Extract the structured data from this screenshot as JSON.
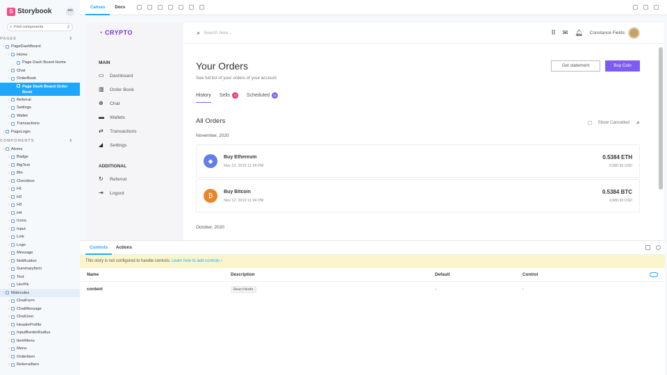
{
  "storybook": {
    "title": "Storybook",
    "search_placeholder": "Find components",
    "search_key": "/",
    "sections": [
      {
        "label": "PAGES"
      },
      {
        "label": "COMPONENTS"
      }
    ],
    "pages_tree": [
      {
        "label": "PageDashBoard",
        "level": 0
      },
      {
        "label": "Home",
        "level": 1
      },
      {
        "label": "Page Dash Board Home",
        "level": 2
      },
      {
        "label": "Chat",
        "level": 1
      },
      {
        "label": "OrderBook",
        "level": 1
      },
      {
        "label": "Page Dash Board Order Book",
        "level": 2,
        "selected": true
      },
      {
        "label": "Referral",
        "level": 1
      },
      {
        "label": "Settings",
        "level": 1
      },
      {
        "label": "Wallet",
        "level": 1
      },
      {
        "label": "Transactions",
        "level": 1
      },
      {
        "label": "PageLogin",
        "level": 0
      }
    ],
    "components_tree": [
      {
        "label": "Atoms",
        "level": 0
      },
      {
        "label": "Badge",
        "level": 1
      },
      {
        "label": "BigText",
        "level": 1
      },
      {
        "label": "Btn",
        "level": 1
      },
      {
        "label": "Checkbox",
        "level": 1
      },
      {
        "label": "H1",
        "level": 1
      },
      {
        "label": "H2",
        "level": 1
      },
      {
        "label": "H3",
        "level": 1
      },
      {
        "label": "H4",
        "level": 1
      },
      {
        "label": "Icons",
        "level": 1
      },
      {
        "label": "Input",
        "level": 1
      },
      {
        "label": "Link",
        "level": 1
      },
      {
        "label": "Logo",
        "level": 1
      },
      {
        "label": "Message",
        "level": 1
      },
      {
        "label": "Notification",
        "level": 1
      },
      {
        "label": "SummaryItem",
        "level": 1
      },
      {
        "label": "Text",
        "level": 1
      },
      {
        "label": "UerPik",
        "level": 1
      },
      {
        "label": "Molecules",
        "level": 0,
        "highlight": true
      },
      {
        "label": "ChatForm",
        "level": 1
      },
      {
        "label": "ChatMessage",
        "level": 1
      },
      {
        "label": "ChatUser",
        "level": 1
      },
      {
        "label": "HeaderProfile",
        "level": 1
      },
      {
        "label": "InputBorderRadius",
        "level": 1
      },
      {
        "label": "ItemMenu",
        "level": 1
      },
      {
        "label": "Menu",
        "level": 1
      },
      {
        "label": "OrderItem",
        "level": 1
      },
      {
        "label": "ReferralItem",
        "level": 1
      }
    ],
    "toolbar_tabs": [
      "Canvas",
      "Docs"
    ],
    "addon_tabs": [
      "Controls",
      "Actions"
    ],
    "warning_text": "This story is not configured to handle controls.",
    "warning_link": "Learn how to add controls ›",
    "table_headers": [
      "Name",
      "Description",
      "Default",
      "Control"
    ],
    "table_row": {
      "name": "content",
      "description": "ReactNode",
      "default": "-",
      "control": "-"
    }
  },
  "app": {
    "brand": "CRYPTO",
    "search_placeholder": "Search here...",
    "user_name": "Constance Fields",
    "main_group": "MAIN",
    "additional_group": "ADDITIONAL",
    "menu_main": [
      {
        "label": "Dashboard",
        "icon": "dashboard-icon",
        "glyph": "▭"
      },
      {
        "label": "Order Book",
        "icon": "order-book-icon",
        "glyph": "▥"
      },
      {
        "label": "Chat",
        "icon": "globe-icon",
        "glyph": "⊕"
      },
      {
        "label": "Wallets",
        "icon": "wallet-icon",
        "glyph": "▬"
      },
      {
        "label": "Transactions",
        "icon": "transactions-icon",
        "glyph": "⇄"
      },
      {
        "label": "Settings",
        "icon": "settings-icon",
        "glyph": "◢"
      }
    ],
    "menu_additional": [
      {
        "label": "Referral",
        "icon": "refresh-icon",
        "glyph": "↻"
      },
      {
        "label": "Logout",
        "icon": "logout-icon",
        "glyph": "⇥"
      }
    ],
    "page_title": "Your Orders",
    "page_subtitle": "See full list of your orders of your account",
    "btn_statement": "Get statement",
    "btn_buy": "Buy Coin",
    "tabs": [
      {
        "label": "History"
      },
      {
        "label": "Sells",
        "badge": "10",
        "color": "#e8336b"
      },
      {
        "label": "Scheduled",
        "badge": "10",
        "color": "#7c5cf4"
      }
    ],
    "orders_title": "All Orders",
    "show_cancelled": "Show Cancelled",
    "month1": "November, 2020",
    "month2": "October, 2020",
    "orders": [
      {
        "name": "Buy Ethereum",
        "date": "Nov 12, 2019 11:34 PM",
        "amount": "0.5384 ETH",
        "usd": "3,980.93 USD",
        "color": "#627eea",
        "glyph": "◆",
        "icon": "ethereum-icon"
      },
      {
        "name": "Buy Bitcoin",
        "date": "Nov 12, 2019 11:34 PM",
        "amount": "0.5384 BTC",
        "usd": "3,980.93 USD",
        "color": "#e9852a",
        "glyph": "₿",
        "icon": "bitcoin-icon"
      }
    ]
  }
}
